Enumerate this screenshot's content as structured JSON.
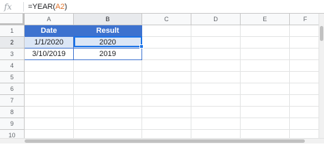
{
  "formula_bar": {
    "icon": "fx-icon",
    "formula_prefix": "=YEAR(",
    "formula_ref": "A2",
    "formula_suffix": ")",
    "ref_color": "#e0732a"
  },
  "columns": [
    "A",
    "B",
    "C",
    "D",
    "E",
    "F"
  ],
  "rows": [
    "1",
    "2",
    "3",
    "4",
    "5",
    "6",
    "7",
    "8",
    "9",
    "10"
  ],
  "table": {
    "headers": [
      "Date",
      "Result"
    ],
    "rows": [
      [
        "1/1/2020",
        "2020"
      ],
      [
        "3/10/2019",
        "2019"
      ]
    ]
  },
  "selection": {
    "active_cell": "B2"
  },
  "colors": {
    "header_fill": "#3d72cf",
    "header_text": "#ffffff",
    "highlight_row": "#dbe6f6",
    "selection_border": "#1a73e8"
  }
}
